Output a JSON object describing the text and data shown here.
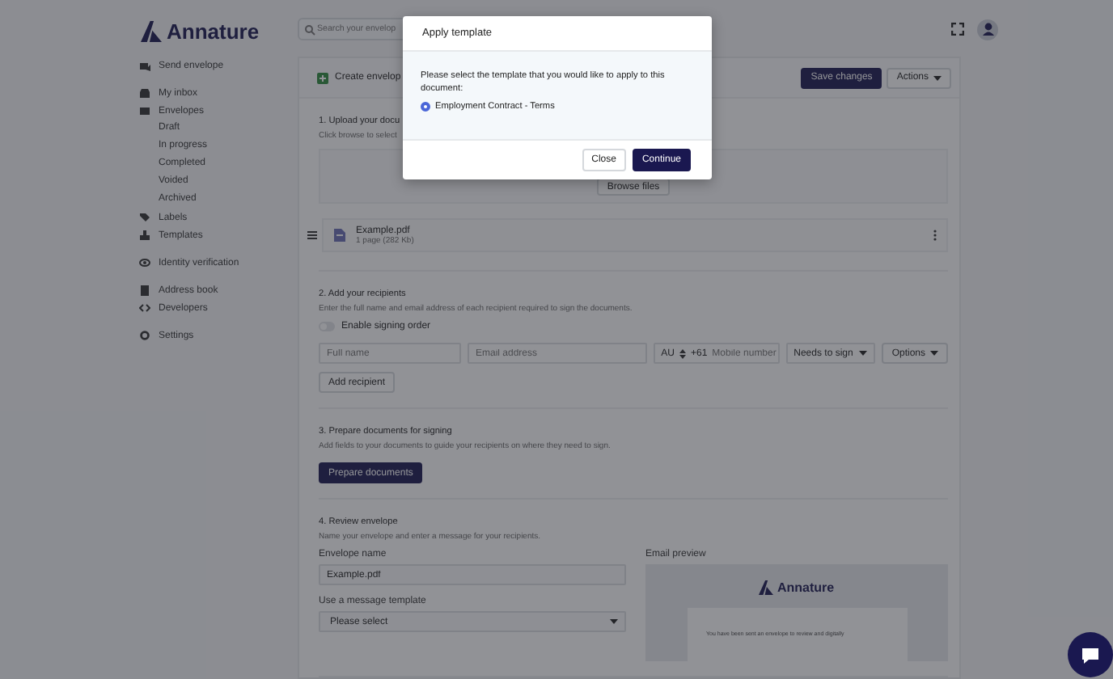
{
  "app": {
    "logo": "Annature",
    "search": {
      "placeholder": "Search your envelop"
    }
  },
  "sidebar": {
    "groups": [
      [
        {
          "label": "Send envelope"
        }
      ],
      [
        {
          "label": "My inbox"
        },
        {
          "label": "Envelopes",
          "children": [
            {
              "label": "Draft"
            },
            {
              "label": "In progress"
            },
            {
              "label": "Completed"
            },
            {
              "label": "Voided"
            },
            {
              "label": "Archived"
            }
          ]
        },
        {
          "label": "Labels"
        },
        {
          "label": "Templates"
        }
      ],
      [
        {
          "label": "Identity verification"
        }
      ],
      [
        {
          "label": "Address book"
        },
        {
          "label": "Developers"
        }
      ],
      [
        {
          "label": "Settings"
        }
      ]
    ]
  },
  "header": {
    "title": "Create envelop",
    "buttons": [
      {
        "label": "Save changes",
        "kind": "primary"
      },
      {
        "label": "Actions",
        "kind": "dropdown"
      }
    ]
  },
  "upload": {
    "title": "1. Upload your docu",
    "subtitle": "Click browse to select",
    "browse": "Browse files",
    "file": {
      "name": "Example.pdf",
      "meta": "1 page (282 Kb)"
    }
  },
  "recipients": {
    "title": "2. Add your recipients",
    "subtitle": "Enter the full name and email address of each recipient required to sign the documents.",
    "signing_order": {
      "label": "Enable signing order",
      "on": false
    },
    "row": {
      "name": {
        "placeholder": "Full name"
      },
      "email": {
        "placeholder": "Email address"
      },
      "country": "AU",
      "code": "+61",
      "mobile": {
        "placeholder": "Mobile number"
      },
      "role": "Needs to sign",
      "options": "Options"
    },
    "add": "Add recipient"
  },
  "prepare": {
    "title": "3. Prepare documents for signing",
    "subtitle": "Add fields to your documents to guide your recipients on where they need to sign.",
    "button": "Prepare documents"
  },
  "review": {
    "title": "4. Review envelope",
    "subtitle": "Name your envelope and enter a message for your recipients.",
    "name_label": "Envelope name",
    "name_value": "Example.pdf",
    "template_label": "Use a message template",
    "template_value": "Please select",
    "preview_label": "Email preview",
    "preview_logo": "Annature",
    "preview_text": "You have been sent an envelope to review and digitally"
  },
  "modal": {
    "title": "Apply template",
    "message": "Please select the template that you would like to apply to this document:",
    "options": [
      {
        "label": "Employment Contract - Terms",
        "selected": true
      }
    ],
    "buttons": [
      {
        "label": "Close",
        "kind": "secondary"
      },
      {
        "label": "Continue",
        "kind": "primary"
      }
    ]
  }
}
